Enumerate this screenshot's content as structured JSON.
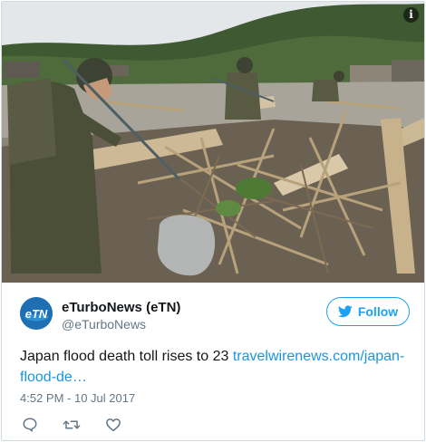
{
  "tweet": {
    "display_name": "eTurboNews (eTN)",
    "handle": "@eTurboNews",
    "avatar_text": "eTN",
    "follow_label": "Follow",
    "text_prefix": "Japan flood death toll rises to 23 ",
    "link_text": "travelwirenews.com/japan-flood-de…",
    "timestamp": "4:52 PM - 10 Jul 2017",
    "media_info_icon": "info-icon",
    "actions": [
      {
        "name": "reply-icon"
      },
      {
        "name": "retweet-icon"
      },
      {
        "name": "like-icon"
      }
    ]
  },
  "colors": {
    "brand_blue": "#1da1f2",
    "link_blue": "#1b95e0",
    "secondary_text": "#657786"
  }
}
